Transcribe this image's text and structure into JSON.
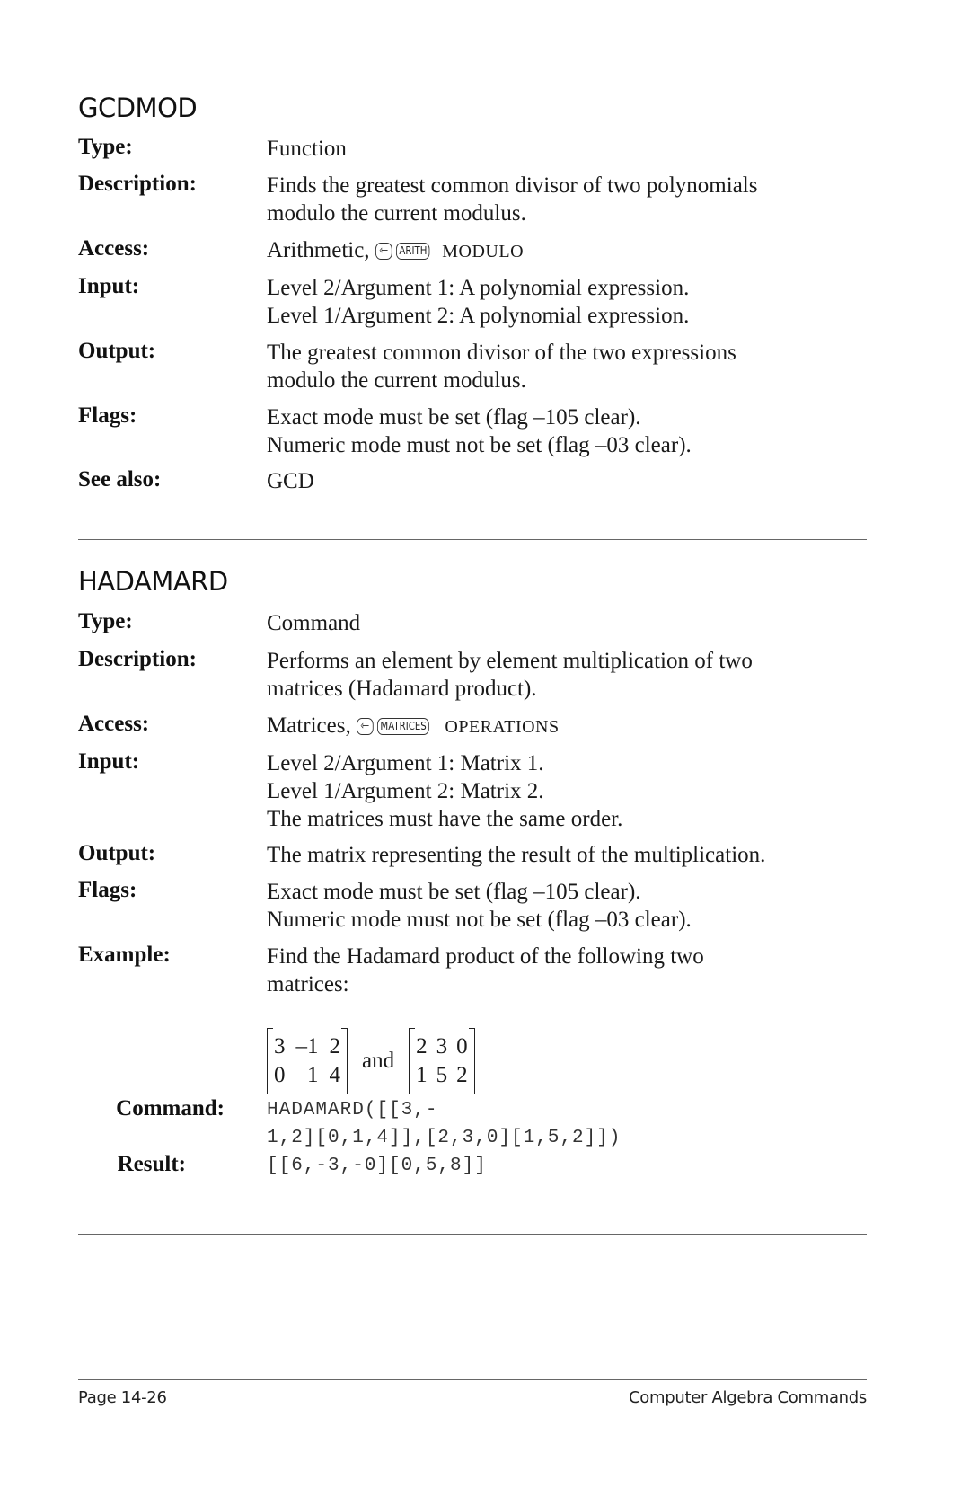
{
  "entries": [
    {
      "title": "GCDMOD",
      "fields": {
        "type": {
          "label": "Type:",
          "value": "Function"
        },
        "description": {
          "label": "Description:",
          "lines": [
            "Finds the greatest common divisor of two polynomials",
            "modulo the current modulus."
          ]
        },
        "access": {
          "label": "Access:",
          "prefix": "Arithmetic, ",
          "keys": [
            {
              "icon": "left-shift-arrow-icon",
              "glyph": "⇽"
            },
            {
              "icon": "arith-key-icon",
              "glyph": "ARITH"
            }
          ],
          "menu": "MODULO"
        },
        "input": {
          "label": "Input:",
          "lines": [
            "Level 2/Argument 1: A polynomial expression.",
            "Level 1/Argument 2: A polynomial expression."
          ]
        },
        "output": {
          "label": "Output:",
          "lines": [
            "The greatest common divisor of the two expressions",
            "modulo the current modulus."
          ]
        },
        "flags": {
          "label": "Flags:",
          "lines": [
            "Exact mode must be set (flag –105 clear).",
            "Numeric mode must not be set (flag –03 clear)."
          ]
        },
        "see_also": {
          "label": "See also:",
          "value": "GCD"
        }
      }
    },
    {
      "title": "HADAMARD",
      "fields": {
        "type": {
          "label": "Type:",
          "value": "Command"
        },
        "description": {
          "label": "Description:",
          "lines": [
            "Performs an element by element multiplication of two",
            "matrices (Hadamard product)."
          ]
        },
        "access": {
          "label": "Access:",
          "prefix": "Matrices, ",
          "keys": [
            {
              "icon": "left-shift-arrow-icon",
              "glyph": "⇽"
            },
            {
              "icon": "matrices-key-icon",
              "glyph": "MATRICES"
            }
          ],
          "menu": "OPERATIONS"
        },
        "input": {
          "label": "Input:",
          "lines": [
            "Level 2/Argument 1: Matrix 1.",
            "Level 1/Argument 2: Matrix 2.",
            "The matrices must have the same order."
          ]
        },
        "output": {
          "label": "Output:",
          "value": "The matrix representing the result of the multiplication."
        },
        "flags": {
          "label": "Flags:",
          "lines": [
            "Exact mode must be set (flag –105 clear).",
            "Numeric mode must not be set (flag –03 clear)."
          ]
        },
        "example": {
          "label": "Example:",
          "lines": [
            "Find the Hadamard product of the following two",
            "matrices:"
          ],
          "matrix1": [
            [
              "3",
              "–1",
              "2"
            ],
            [
              "0",
              "1",
              "4"
            ]
          ],
          "joiner": "and",
          "matrix2": [
            [
              "2",
              "3",
              "0"
            ],
            [
              "1",
              "5",
              "2"
            ]
          ]
        },
        "command": {
          "label": "Command:",
          "lines": [
            "HADAMARD([[3,-",
            "1,2][0,1,4]],[2,3,0][1,5,2]])"
          ]
        },
        "result": {
          "label": "Result:",
          "value": "[[6,-3,-0][0,5,8]]"
        }
      }
    }
  ],
  "footer": {
    "page": "Page 14-26",
    "section": "Computer Algebra Commands"
  }
}
